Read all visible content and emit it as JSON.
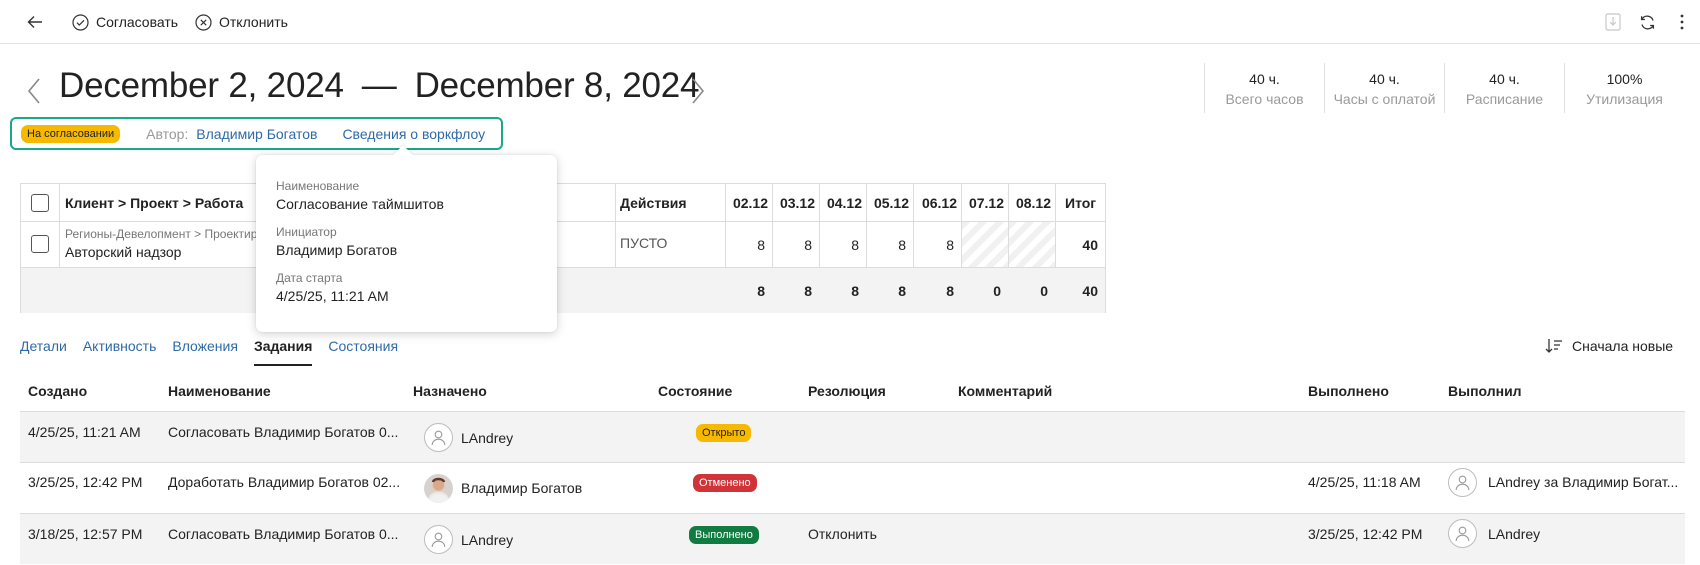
{
  "toolbar": {
    "approve_label": "Согласовать",
    "reject_label": "Отклонить"
  },
  "header": {
    "date_from": "December 2, 2024",
    "date_sep": "—",
    "date_to": "December 8, 2024"
  },
  "stats": [
    {
      "value": "40 ч.",
      "label": "Всего часов"
    },
    {
      "value": "40 ч.",
      "label": "Часы с оплатой"
    },
    {
      "value": "40 ч.",
      "label": "Расписание"
    },
    {
      "value": "100%",
      "label": "Утилизация"
    }
  ],
  "status": {
    "badge": "На согласовании",
    "author_label": "Автор:",
    "author_name": "Владимир Богатов",
    "workflow_link": "Сведения о воркфлоу"
  },
  "grid": {
    "headers": {
      "project": "Клиент > Проект > Работа",
      "actions": "Действия",
      "days": [
        "02.12",
        "03.12",
        "04.12",
        "05.12",
        "06.12",
        "07.12",
        "08.12"
      ],
      "total": "Итог"
    },
    "row": {
      "path": "Регионы-Девелопмент > Проектир",
      "work": "Авторский надзор",
      "action": "ПУСТО",
      "values": [
        "8",
        "8",
        "8",
        "8",
        "8",
        "",
        ""
      ],
      "total": "40"
    },
    "totals": {
      "values": [
        "8",
        "8",
        "8",
        "8",
        "8",
        "0",
        "0"
      ],
      "total": "40"
    }
  },
  "tooltip": {
    "name_label": "Наименование",
    "name_value": "Согласование таймшитов",
    "initiator_label": "Инициатор",
    "initiator_value": "Владимир Богатов",
    "start_label": "Дата старта",
    "start_value": "4/25/25, 11:21 AM"
  },
  "tabs": [
    {
      "label": "Детали"
    },
    {
      "label": "Активность"
    },
    {
      "label": "Вложения"
    },
    {
      "label": "Задания",
      "active": true
    },
    {
      "label": "Состояния"
    }
  ],
  "sort_label": "Сначала новые",
  "tasks": {
    "columns": {
      "created": "Создано",
      "name": "Наименование",
      "assigned": "Назначено",
      "state": "Состояние",
      "resolution": "Резолюция",
      "comment": "Комментарий",
      "completed": "Выполнено",
      "completed_by": "Выполнил"
    },
    "rows": [
      {
        "created": "4/25/25, 11:21 AM",
        "name": "Согласовать Владимир Богатов 0...",
        "assigned": "LAndrey",
        "state": "Открыто",
        "state_color": "#f7b900",
        "resolution": "",
        "comment": "",
        "completed": "",
        "completed_by": ""
      },
      {
        "created": "3/25/25, 12:42 PM",
        "name": "Доработать Владимир Богатов 02...",
        "assigned": "Владимир Богатов",
        "state": "Отменено",
        "state_color": "#d13438",
        "resolution": "",
        "comment": "",
        "completed": "4/25/25, 11:18 AM",
        "completed_by": "LAndrey за Владимир Богат..."
      },
      {
        "created": "3/18/25, 12:57 PM",
        "name": "Согласовать Владимир Богатов 0...",
        "assigned": "LAndrey",
        "state": "Выполнено",
        "state_color": "#107c41",
        "resolution": "Отклонить",
        "comment": "",
        "completed": "3/25/25, 12:42 PM",
        "completed_by": "LAndrey"
      }
    ]
  },
  "colors": {
    "accent_link": "#2f6aa8",
    "status_border": "#1aa88a"
  }
}
